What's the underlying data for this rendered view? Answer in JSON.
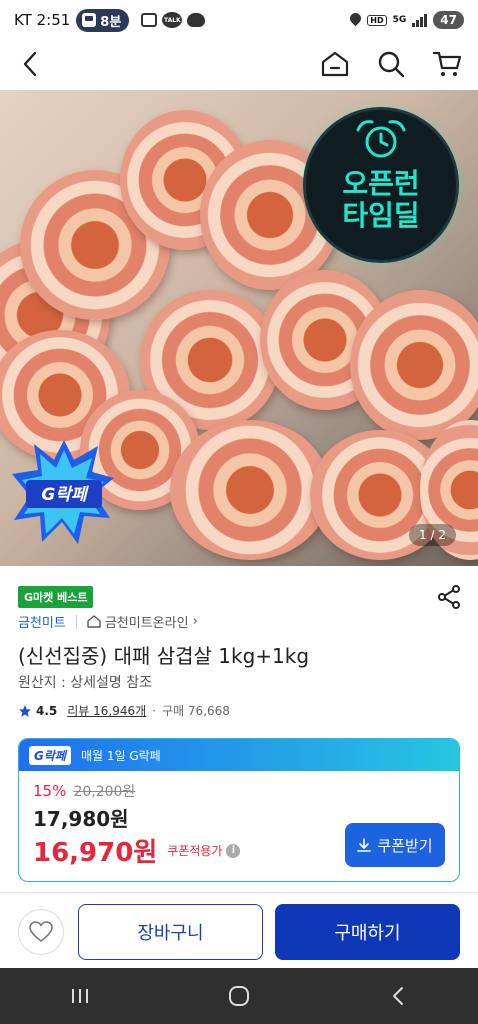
{
  "status_bar": {
    "carrier_time": "KT 2:51",
    "bus_eta": "8분",
    "talk_label": "TALK",
    "hd": "HD",
    "network": "5G",
    "battery": "47"
  },
  "hero": {
    "badge_line1": "오픈런",
    "badge_line2": "타임딜",
    "grakpe_text": "G락페",
    "image_counter": "1 / 2"
  },
  "product": {
    "best_tag": "G마켓 베스트",
    "seller": "금천미트",
    "store": "금천미트온라인",
    "store_chevron": "›",
    "title": "(신선집중) 대패 삼겹살 1kg+1kg",
    "origin": "원산지 : 상세설명 참조",
    "rating": "4.5",
    "reviews": "리뷰 16,946개",
    "dot": "·",
    "purchases": "구매 76,668"
  },
  "deal": {
    "logo": "G락페",
    "header_text": "매월 1일 G락페",
    "discount_pct": "15%",
    "original_price": "20,200원",
    "sale_price": "17,980원",
    "coupon_price": "16,970원",
    "coupon_note": "쿠폰적용가",
    "info_symbol": "i",
    "coupon_button": "쿠폰받기"
  },
  "actions": {
    "cart": "장바구니",
    "buy": "구매하기"
  },
  "colors": {
    "accent_blue": "#0e38b8",
    "sale_red": "#e5263d",
    "best_green": "#1aa33b"
  }
}
